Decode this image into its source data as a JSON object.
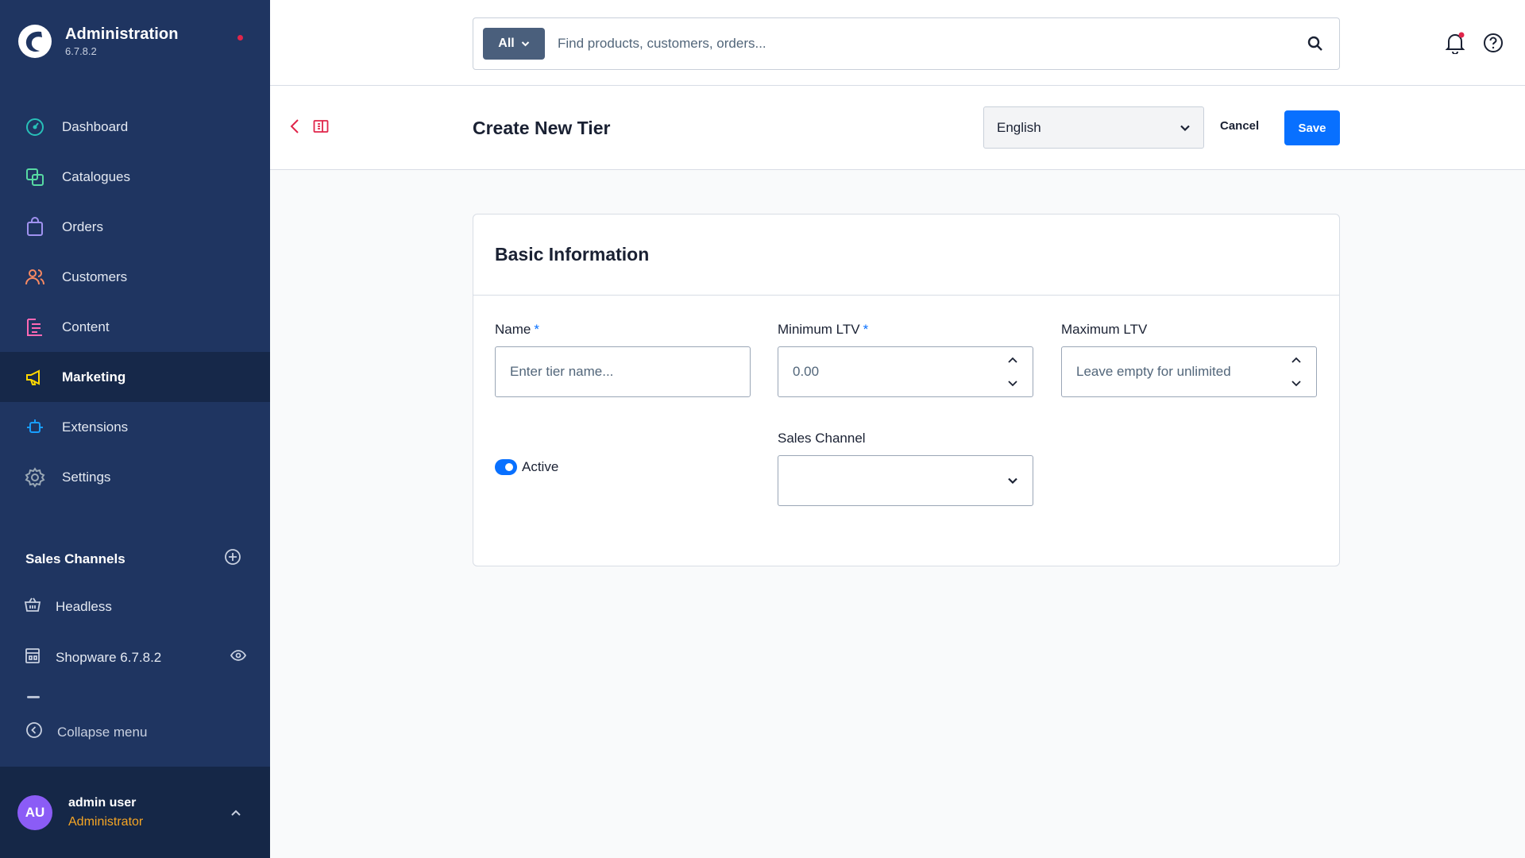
{
  "brand": {
    "title": "Administration",
    "version": "6.7.8.2"
  },
  "nav": [
    {
      "label": "Dashboard",
      "icon": "dashboard-icon",
      "color": "#28c0b8"
    },
    {
      "label": "Catalogues",
      "icon": "catalogues-icon",
      "color": "#57d9a3"
    },
    {
      "label": "Orders",
      "icon": "orders-icon",
      "color": "#a092f0"
    },
    {
      "label": "Customers",
      "icon": "customers-icon",
      "color": "#f88962"
    },
    {
      "label": "Content",
      "icon": "content-icon",
      "color": "#ff68b4"
    },
    {
      "label": "Marketing",
      "icon": "marketing-icon",
      "color": "#ffd700"
    },
    {
      "label": "Extensions",
      "icon": "extensions-icon",
      "color": "#189eff"
    },
    {
      "label": "Settings",
      "icon": "settings-icon",
      "color": "#9aa8b5"
    }
  ],
  "active_nav": "Marketing",
  "sales_channels": {
    "title": "Sales Channels",
    "items": [
      {
        "label": "Headless",
        "icon": "basket-icon"
      },
      {
        "label": "Shopware 6.7.8.2",
        "icon": "storefront-icon"
      }
    ]
  },
  "collapse_label": "Collapse menu",
  "user": {
    "initials": "AU",
    "name": "admin user",
    "role": "Administrator"
  },
  "search": {
    "type": "All",
    "placeholder": "Find products, customers, orders..."
  },
  "header": {
    "title": "Create New Tier",
    "language": "English",
    "cancel": "Cancel",
    "save": "Save"
  },
  "card": {
    "title": "Basic Information",
    "name": {
      "label": "Name",
      "required": "*",
      "placeholder": "Enter tier name..."
    },
    "min_ltv": {
      "label": "Minimum LTV",
      "required": "*",
      "placeholder": "0.00"
    },
    "max_ltv": {
      "label": "Maximum LTV",
      "placeholder": "Leave empty for unlimited"
    },
    "active": {
      "label": "Active",
      "checked": true
    },
    "sales_channel": {
      "label": "Sales Channel",
      "value": ""
    }
  },
  "colors": {
    "sidebar": "#1f3561",
    "accent": "#0870ff",
    "role": "#f5a524",
    "avatar": "#8b5cf6"
  }
}
